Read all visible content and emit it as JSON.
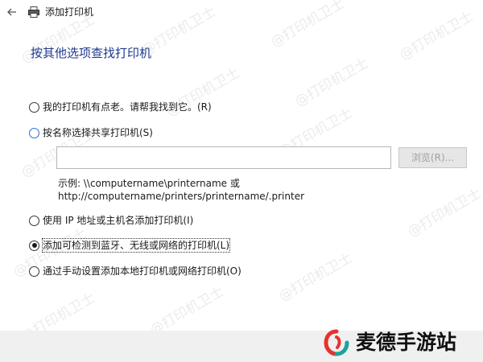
{
  "window": {
    "title": "添加打印机",
    "back_icon": "back-arrow-icon",
    "app_icon": "printer-icon"
  },
  "heading": "按其他选项查找打印机",
  "options": [
    {
      "label": "我的打印机有点老。请帮我找到它。(R)",
      "selected": false
    },
    {
      "label": "按名称选择共享打印机(S)",
      "selected": false
    },
    {
      "label": "使用 IP 地址或主机名添加打印机(I)",
      "selected": false
    },
    {
      "label": "添加可检测到蓝牙、无线或网络的打印机(L)",
      "selected": true
    },
    {
      "label": "通过手动设置添加本地打印机或网络打印机(O)",
      "selected": false
    }
  ],
  "share_input": {
    "value": "",
    "placeholder": ""
  },
  "browse_label": "浏览(R)...",
  "example": {
    "line1": "示例: \\\\computername\\printername 或",
    "line2": "http://computername/printers/printername/.printer"
  },
  "watermark_text": "@打印机卫士",
  "brand": {
    "name": "麦德手游站",
    "logo_icon": "brand-logo-icon"
  },
  "colors": {
    "heading": "#1f3a8f",
    "radio_focus": "#2a6fd6",
    "brand_red": "#e8322e",
    "brand_teal": "#1aa39a"
  }
}
